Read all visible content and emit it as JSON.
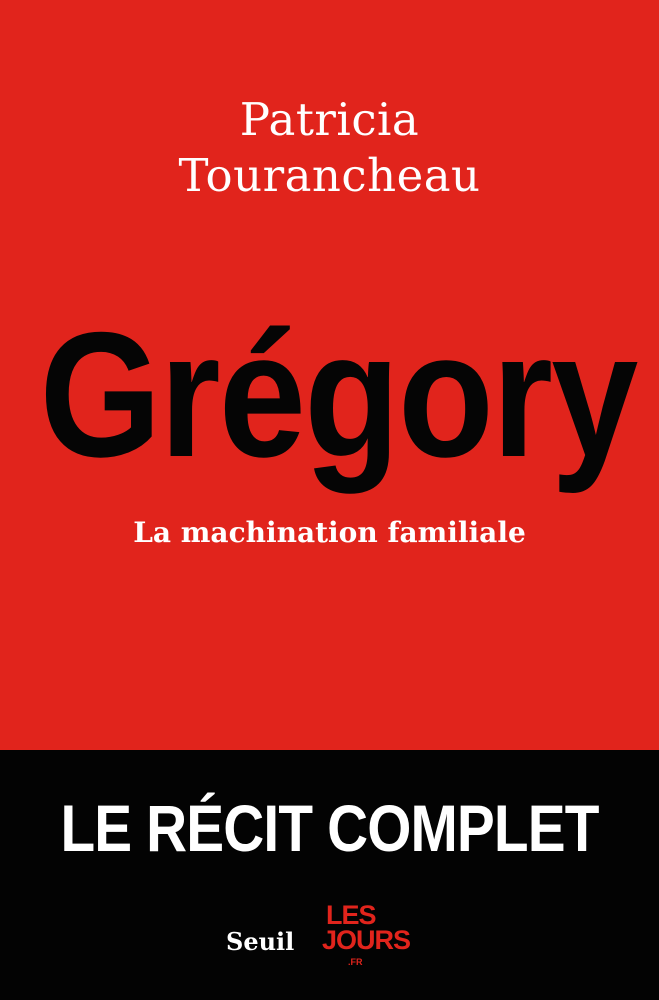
{
  "cover": {
    "author_first": "Patricia",
    "author_last": "Tourancheau",
    "title": "Grégory",
    "subtitle": "La machination familiale",
    "band_text": "LE RÉCIT COMPLET",
    "publisher": "Seuil",
    "partner_logo": {
      "line1": "LES",
      "line2": "JOURS",
      "suffix": ".FR"
    }
  },
  "colors": {
    "background": "#e1241c",
    "band": "#030303",
    "title": "#050505",
    "text_light": "#ffffff",
    "logo": "#e1241c"
  }
}
